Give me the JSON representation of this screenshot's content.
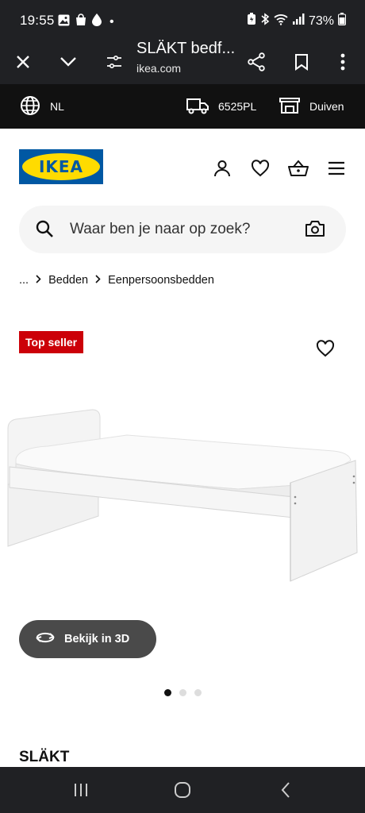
{
  "statusbar": {
    "time": "19:55",
    "battery": "73%",
    "notification_dot": "•"
  },
  "browser": {
    "title": "SLÄKT bedf...",
    "domain": "ikea.com"
  },
  "topstrip": {
    "language": "NL",
    "postcode": "6525PL",
    "store": "Duiven"
  },
  "header": {
    "logo_text": "IKEA",
    "brand_colors": {
      "blue": "#0058a3",
      "yellow": "#ffdb00"
    }
  },
  "search": {
    "placeholder": "Waar ben je naar op zoek?"
  },
  "breadcrumb": {
    "ellipsis": "...",
    "items": [
      "Bedden",
      "Eenpersoonsbedden"
    ]
  },
  "product": {
    "badge": "Top seller",
    "badge_color": "#cc0008",
    "view3d_label": "Bekijk in 3D",
    "image_count": 3,
    "active_image": 1,
    "name": "SLÄKT"
  },
  "icons": {
    "status": [
      "gallery-icon",
      "shopping-bag-icon",
      "drop-icon",
      "battery-saver-icon",
      "bluetooth-icon",
      "wifi-icon",
      "signal-icon",
      "battery-icon"
    ],
    "browser": [
      "close-icon",
      "chevron-down-icon",
      "site-settings-icon",
      "share-icon",
      "bookmark-icon",
      "more-vert-icon"
    ],
    "topstrip": [
      "globe-icon",
      "truck-icon",
      "store-icon"
    ],
    "header": [
      "user-icon",
      "heart-icon",
      "basket-icon",
      "menu-icon"
    ],
    "search": [
      "search-icon",
      "camera-icon"
    ],
    "nav": [
      "recents-icon",
      "home-icon",
      "back-icon"
    ]
  }
}
